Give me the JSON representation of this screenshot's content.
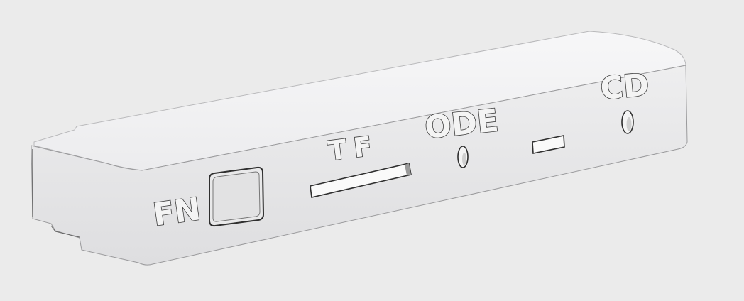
{
  "part": {
    "labels": {
      "fn": "FN",
      "tf": "TF",
      "ode": "ODE",
      "cd": "CD"
    },
    "colors": {
      "background": "#ebebeb",
      "front_face": "#e4e4e6",
      "top_face": "#f2f2f3",
      "outline": "#3a3a3a"
    }
  }
}
